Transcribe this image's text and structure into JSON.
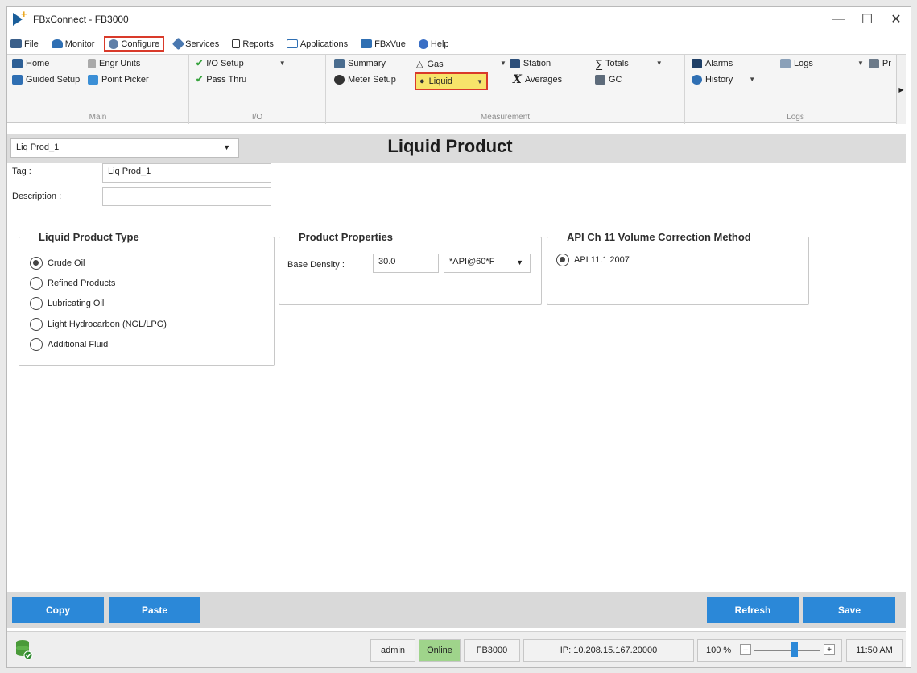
{
  "window": {
    "title": "FBxConnect - FB3000"
  },
  "menu": {
    "items": [
      {
        "label": "File",
        "icon": "folder-icon"
      },
      {
        "label": "Monitor",
        "icon": "monitor-user-icon"
      },
      {
        "label": "Configure",
        "icon": "gear-icon",
        "active": true
      },
      {
        "label": "Services",
        "icon": "tools-icon"
      },
      {
        "label": "Reports",
        "icon": "document-icon"
      },
      {
        "label": "Applications",
        "icon": "window-icon"
      },
      {
        "label": "FBxVue",
        "icon": "user-icon"
      },
      {
        "label": "Help",
        "icon": "help-icon"
      }
    ]
  },
  "ribbon": {
    "main": {
      "label": "Main",
      "home": "Home",
      "engr_units": "Engr Units",
      "guided_setup": "Guided Setup",
      "point_picker": "Point Picker"
    },
    "io": {
      "label": "I/O",
      "io_setup": "I/O Setup",
      "pass_thru": "Pass Thru"
    },
    "measurement": {
      "label": "Measurement",
      "summary": "Summary",
      "meter_setup": "Meter Setup",
      "gas": "Gas",
      "liquid": "Liquid",
      "station": "Station",
      "averages": "Averages",
      "totals": "Totals",
      "gc": "GC"
    },
    "logs": {
      "label": "Logs",
      "alarms": "Alarms",
      "history": "History",
      "logs": "Logs",
      "pr": "Pr"
    }
  },
  "header": {
    "selector_value": "Liq Prod_1",
    "title": "Liquid Product"
  },
  "form": {
    "tag_label": "Tag :",
    "tag_value": "Liq Prod_1",
    "description_label": "Description :",
    "description_value": ""
  },
  "liquid_product_type": {
    "legend": "Liquid Product Type",
    "options": [
      "Crude Oil",
      "Refined Products",
      "Lubricating Oil",
      "Light Hydrocarbon (NGL/LPG)",
      "Additional Fluid"
    ],
    "selected": "Crude Oil"
  },
  "product_properties": {
    "legend": "Product Properties",
    "base_density_label": "Base Density :",
    "base_density_value": "30.0",
    "unit": "*API@60*F"
  },
  "api_ch11": {
    "legend": "API Ch 11 Volume Correction Method",
    "option": "API 11.1 2007",
    "selected": true
  },
  "buttons": {
    "copy": "Copy",
    "paste": "Paste",
    "refresh": "Refresh",
    "save": "Save"
  },
  "status": {
    "user": "admin",
    "connection": "Online",
    "device": "FB3000",
    "ip": "IP: 10.208.15.167.20000",
    "zoom": "100 %",
    "zoom_level": 0.6,
    "time": "11:50 AM"
  },
  "colors": {
    "accent_blue": "#2b88d8",
    "online_green": "#9fd48b",
    "highlight_yellow": "#f7e46a",
    "selection_red": "#d93a2a"
  }
}
